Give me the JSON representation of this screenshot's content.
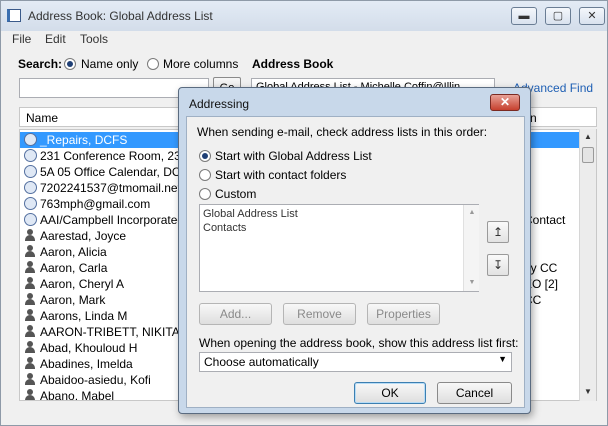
{
  "window": {
    "title": "Address Book: Global Address List",
    "min": "▬",
    "max": "▢",
    "close": "✕"
  },
  "menu": [
    "File",
    "Edit",
    "Tools"
  ],
  "search": {
    "label": "Search:",
    "opt_name_only": "Name only",
    "opt_more_columns": "More columns",
    "address_book_label": "Address Book",
    "input_value": "",
    "go_label": "Go",
    "address_book_value": "Global Address List - Michelle.Coffin@Illin",
    "advanced_find": "Advanced Find"
  },
  "list": {
    "col_name": "Name",
    "col_right": "n",
    "rows": [
      {
        "name": "_Repairs, DCFS",
        "right": "",
        "icon": "globe-icon",
        "selected": true
      },
      {
        "name": "231 Conference Room, 231",
        "right": "",
        "icon": "globe-icon"
      },
      {
        "name": "5A  05 Office Calendar, DCF",
        "right": "",
        "icon": "globe-icon"
      },
      {
        "name": "7202241537@tmomail.net",
        "right": "",
        "icon": "globe-icon"
      },
      {
        "name": "763mph@gmail.com",
        "right": "",
        "icon": "globe-icon"
      },
      {
        "name": "AAI/Campbell Incorporated",
        "right": "Contact",
        "icon": "globe-icon"
      },
      {
        "name": "Aarestad, Joyce",
        "right": "",
        "icon": "person-icon"
      },
      {
        "name": "Aaron, Alicia",
        "right": "",
        "icon": "person-icon"
      },
      {
        "name": "Aaron, Carla",
        "right": "dy CC",
        "icon": "person-icon"
      },
      {
        "name": "Aaron, Cheryl A",
        "right": "EO [2]",
        "icon": "person-icon"
      },
      {
        "name": "Aaron, Mark",
        "right": "CC",
        "icon": "person-icon"
      },
      {
        "name": "Aarons, Linda M",
        "right": "",
        "icon": "person-icon"
      },
      {
        "name": "AARON-TRIBETT, NIKITA",
        "right": "",
        "icon": "person-icon"
      },
      {
        "name": "Abad, Khouloud H",
        "right": "",
        "icon": "person-icon"
      },
      {
        "name": "Abadines, Imelda",
        "right": "",
        "icon": "person-icon"
      },
      {
        "name": "Abaidoo-asiedu, Kofi",
        "right": "",
        "icon": "person-icon"
      },
      {
        "name": "Abano, Mabel",
        "right": "",
        "icon": "person-icon"
      }
    ]
  },
  "dialog": {
    "title": "Addressing",
    "close": "✕",
    "instruction": "When sending e-mail, check address lists in this order:",
    "opt_global": "Start with Global Address List",
    "opt_contacts": "Start with contact folders",
    "opt_custom": "Custom",
    "lists": [
      "Global Address List",
      "Contacts"
    ],
    "move_up": "↥",
    "move_down": "↧",
    "btn_add": "Add...",
    "btn_remove": "Remove",
    "btn_properties": "Properties",
    "open_label": "When opening the address book, show this address list first:",
    "open_value": "Choose automatically",
    "ok": "OK",
    "cancel": "Cancel"
  }
}
